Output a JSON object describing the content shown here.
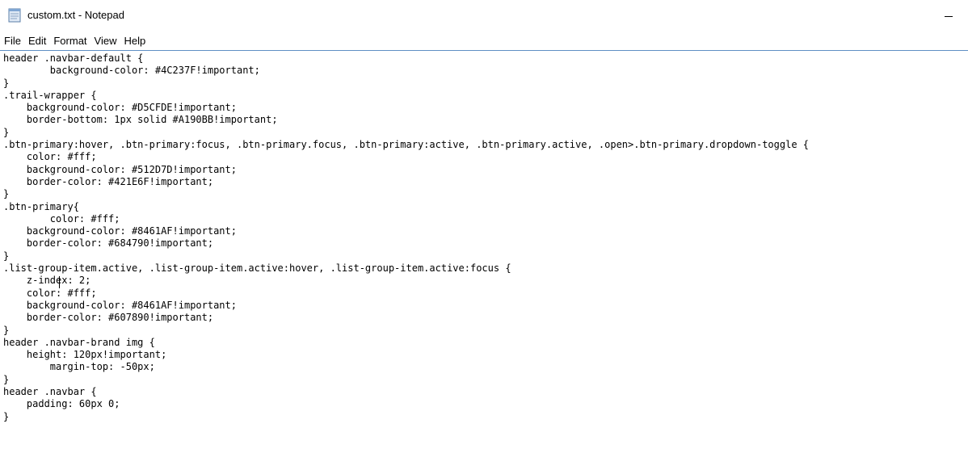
{
  "window": {
    "title": "custom.txt - Notepad",
    "icon": "notepad-icon",
    "minimize_icon": "minimize-icon"
  },
  "menu": {
    "items": [
      {
        "label": "File"
      },
      {
        "label": "Edit"
      },
      {
        "label": "Format"
      },
      {
        "label": "View"
      },
      {
        "label": "Help"
      }
    ]
  },
  "editor": {
    "lines": [
      "header .navbar-default {",
      "        background-color: #4C237F!important;",
      "}",
      ".trail-wrapper {",
      "    background-color: #D5CFDE!important;",
      "    border-bottom: 1px solid #A190BB!important;",
      "}",
      ".btn-primary:hover, .btn-primary:focus, .btn-primary.focus, .btn-primary:active, .btn-primary.active, .open>.btn-primary.dropdown-toggle {",
      "    color: #fff;",
      "    background-color: #512D7D!important;",
      "    border-color: #421E6F!important;",
      "}",
      ".btn-primary{",
      "        color: #fff;",
      "    background-color: #8461AF!important;",
      "    border-color: #684790!important;",
      "}",
      ".list-group-item.active, .list-group-item.active:hover, .list-group-item.active:focus {",
      "    z-index: 2;",
      "    color: #fff;",
      "    background-color: #8461AF!important;",
      "    border-color: #607890!important;",
      "}",
      "header .navbar-brand img {",
      "    height: 120px!important;",
      "        margin-top: -50px;",
      "}",
      "header .navbar {",
      "    padding: 60px 0;",
      "}"
    ]
  },
  "colors": {
    "menu_border": "#5f8fc4",
    "background": "#ffffff",
    "text": "#000000"
  }
}
